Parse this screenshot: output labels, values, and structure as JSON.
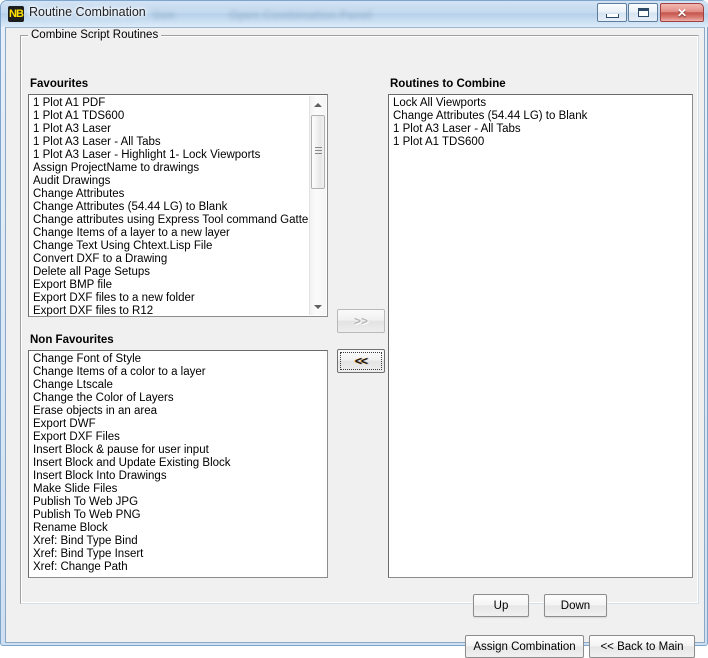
{
  "window": {
    "title": "Routine Combination",
    "icon": "NB",
    "ghost_text_a": "tion",
    "ghost_text_b": "Open Combination Panel",
    "controls": {
      "minimize": "minimize-icon",
      "maximize": "maximize-icon",
      "close": "✕"
    }
  },
  "groupbox": {
    "legend": "Combine Script Routines"
  },
  "favourites": {
    "label": "Favourites",
    "items": [
      "1 Plot A1 PDF",
      "1 Plot A1 TDS600",
      "1 Plot A3 Laser",
      "1 Plot A3 Laser - All Tabs",
      "1 Plot A3 Laser - Highlight 1- Lock Viewports",
      "Assign ProjectName to drawings",
      "Audit Drawings",
      "Change Attributes",
      "Change Attributes (54.44 LG) to Blank",
      "Change attributes using Express Tool command Gatte",
      "Change Items of a layer to a new layer",
      "Change Text Using Chtext.Lisp File",
      "Convert DXF to a Drawing",
      "Delete all Page Setups",
      "Export BMP file",
      "Export DXF files to a new folder",
      "Export DXF files to R12"
    ]
  },
  "non_favourites": {
    "label": "Non Favourites",
    "items": [
      "Change Font of Style",
      "Change Items of a color to a layer",
      "Change Ltscale",
      "Change the Color of Layers",
      "Erase objects in an area",
      "Export DWF",
      "Export DXF Files",
      "Insert Block & pause for user input",
      "Insert Block and Update Existing Block",
      "Insert Block Into Drawings",
      "Make Slide Files",
      "Publish To Web JPG",
      "Publish To Web PNG",
      "Rename Block",
      "Xref: Bind Type Bind",
      "Xref: Bind Type Insert",
      "Xref: Change Path"
    ]
  },
  "routines_to_combine": {
    "label": "Routines to Combine",
    "items": [
      "Lock All Viewports",
      "Change Attributes (54.44 LG) to Blank",
      "1 Plot A3 Laser - All Tabs",
      "1 Plot A1 TDS600"
    ]
  },
  "transfer": {
    "to_right_label": ">>",
    "to_right_enabled": "false",
    "to_left_label": "<<",
    "to_left_enabled": "true"
  },
  "buttons": {
    "up": "Up",
    "down": "Down",
    "assign_combination": "Assign Combination",
    "back_to_main": "<< Back to Main"
  },
  "colors": {
    "window_frame": "#7ea6cc",
    "dialog_face": "#f0f0f0",
    "list_background": "#ffffff",
    "close_button": "#c4554c",
    "disabled_text": "#b4b4b4"
  }
}
